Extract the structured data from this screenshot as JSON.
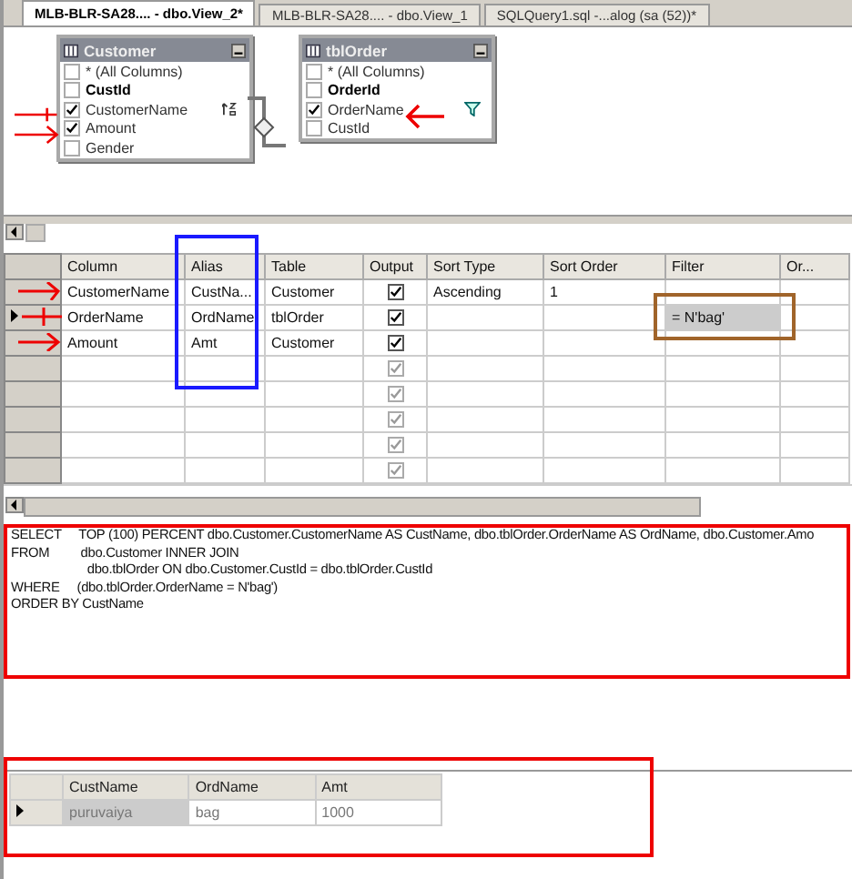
{
  "tabs": [
    {
      "label": "MLB-BLR-SA28.... - dbo.View_2*",
      "selected": true
    },
    {
      "label": "MLB-BLR-SA28.... - dbo.View_1",
      "selected": false
    },
    {
      "label": "SQLQuery1.sql -...alog (sa (52))*",
      "selected": false
    }
  ],
  "diagram": {
    "tables": [
      {
        "title": "Customer",
        "columns": [
          {
            "name": "* (All Columns)",
            "checked": false,
            "primary_key": false,
            "sorted": false,
            "filtered": false
          },
          {
            "name": "CustId",
            "checked": false,
            "primary_key": true,
            "sorted": false,
            "filtered": false
          },
          {
            "name": "CustomerName",
            "checked": true,
            "primary_key": false,
            "sorted": true,
            "filtered": false
          },
          {
            "name": "Amount",
            "checked": true,
            "primary_key": false,
            "sorted": false,
            "filtered": false
          },
          {
            "name": "Gender",
            "checked": false,
            "primary_key": false,
            "sorted": false,
            "filtered": false
          }
        ]
      },
      {
        "title": "tblOrder",
        "columns": [
          {
            "name": "* (All Columns)",
            "checked": false,
            "primary_key": false,
            "sorted": false,
            "filtered": false
          },
          {
            "name": "OrderId",
            "checked": false,
            "primary_key": true,
            "sorted": false,
            "filtered": false
          },
          {
            "name": "OrderName",
            "checked": true,
            "primary_key": false,
            "sorted": false,
            "filtered": true
          },
          {
            "name": "CustId",
            "checked": false,
            "primary_key": false,
            "sorted": false,
            "filtered": false
          }
        ]
      }
    ]
  },
  "criteria_grid": {
    "columns": [
      "Column",
      "Alias",
      "Table",
      "Output",
      "Sort Type",
      "Sort Order",
      "Filter",
      "Or..."
    ],
    "rows": [
      {
        "selected": false,
        "column": "CustomerName",
        "alias": "CustNa...",
        "table": "Customer",
        "output": true,
        "disabled": false,
        "sort_type": "Ascending",
        "sort_order": "1"
      },
      {
        "selected": true,
        "column": "OrderName",
        "alias": "OrdName",
        "table": "tblOrder",
        "output": true,
        "disabled": false,
        "filter": "= N'bag'"
      },
      {
        "selected": false,
        "column": "Amount",
        "alias": "Amt",
        "table": "Customer",
        "output": true,
        "disabled": false
      },
      {
        "selected": false,
        "output": true,
        "disabled": true
      },
      {
        "selected": false,
        "output": true,
        "disabled": true
      },
      {
        "selected": false,
        "output": true,
        "disabled": true
      },
      {
        "selected": false,
        "output": true,
        "disabled": true
      },
      {
        "selected": false,
        "output": true,
        "disabled": true
      }
    ]
  },
  "sql_pane": {
    "lines": [
      "SELECT     TOP (100) PERCENT dbo.Customer.CustomerName AS CustName, dbo.tblOrder.OrderName AS OrdName, dbo.Customer.Amo",
      "FROM         dbo.Customer INNER JOIN",
      "                      dbo.tblOrder ON dbo.Customer.CustId = dbo.tblOrder.CustId",
      "WHERE     (dbo.tblOrder.OrderName = N'bag')",
      "ORDER BY CustName"
    ]
  },
  "results": {
    "columns": [
      "CustName",
      "OrdName",
      "Amt"
    ],
    "rows": [
      {
        "selected": true,
        "cells": [
          "puruvaiya",
          "bag",
          "1000"
        ]
      }
    ]
  }
}
